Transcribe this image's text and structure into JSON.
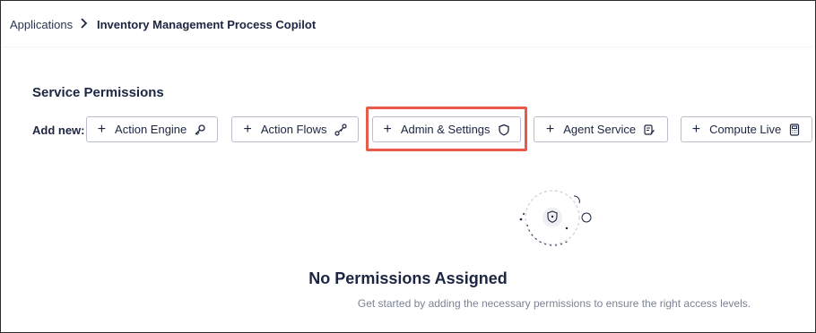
{
  "breadcrumb": {
    "parent": "Applications",
    "current": "Inventory Management Process Copilot"
  },
  "section": {
    "title": "Service Permissions",
    "add_new_label": "Add new:"
  },
  "buttons": [
    {
      "label": "Action Engine",
      "icon": "key-icon"
    },
    {
      "label": "Action Flows",
      "icon": "flow-icon"
    },
    {
      "label": "Admin & Settings",
      "icon": "shield-icon"
    },
    {
      "label": "Agent Service",
      "icon": "agent-icon"
    },
    {
      "label": "Compute Live",
      "icon": "calculator-icon"
    }
  ],
  "empty_state": {
    "title": "No Permissions Assigned",
    "description": "Get started by adding the necessary permissions to ensure the right access levels."
  },
  "colors": {
    "highlight": "#ea5a4a",
    "text_dark": "#1c2541",
    "muted": "#7a8394",
    "border": "#b9bfca"
  }
}
